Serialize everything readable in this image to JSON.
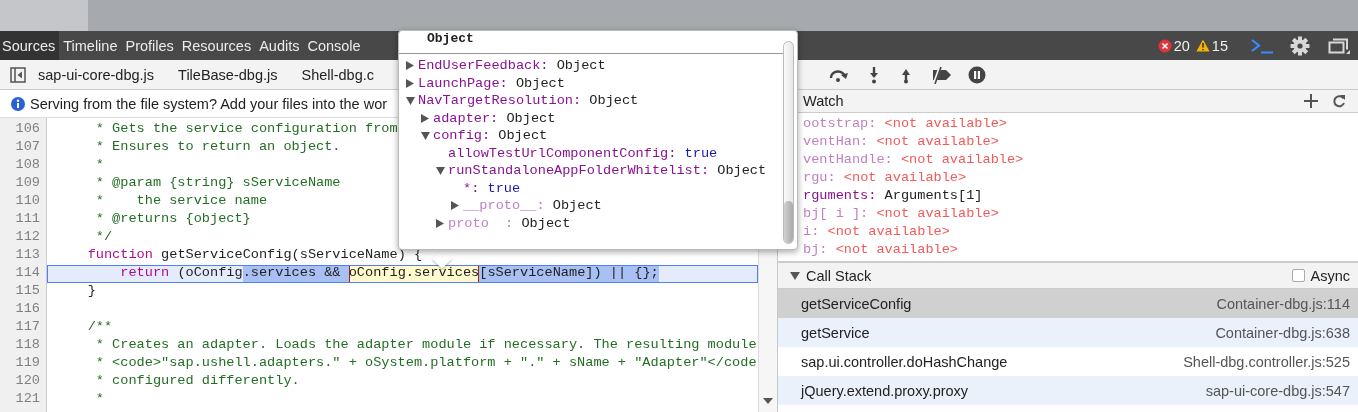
{
  "main_tabs": [
    {
      "label": "Sources",
      "selected": true
    },
    {
      "label": "Timeline",
      "selected": false
    },
    {
      "label": "Profiles",
      "selected": false
    },
    {
      "label": "Resources",
      "selected": false
    },
    {
      "label": "Audits",
      "selected": false
    },
    {
      "label": "Console",
      "selected": false
    }
  ],
  "status": {
    "errors": "20",
    "warnings": "15"
  },
  "file_tabs": [
    {
      "label": "sap-ui-core-dbg.js"
    },
    {
      "label": "TileBase-dbg.js"
    },
    {
      "label": "Shell-dbg.c"
    }
  ],
  "info_bar": {
    "text": "Serving from the file system? Add your files into the wor"
  },
  "code_lines": [
    {
      "number": "106",
      "tokens": [
        {
          "text": "     * Gets the service configuration from",
          "kind": "comment"
        }
      ]
    },
    {
      "number": "107",
      "tokens": [
        {
          "text": "     * Ensures to return an object.",
          "kind": "comment"
        }
      ]
    },
    {
      "number": "108",
      "tokens": [
        {
          "text": "     *",
          "kind": "comment"
        }
      ]
    },
    {
      "number": "109",
      "tokens": [
        {
          "text": "     * @param {string} sServiceName",
          "kind": "comment"
        }
      ]
    },
    {
      "number": "110",
      "tokens": [
        {
          "text": "     *    the service name",
          "kind": "comment"
        }
      ]
    },
    {
      "number": "111",
      "tokens": [
        {
          "text": "     * @returns {object}",
          "kind": "comment"
        }
      ]
    },
    {
      "number": "112",
      "tokens": [
        {
          "text": "     */",
          "kind": "comment"
        }
      ]
    },
    {
      "number": "113",
      "current": false,
      "tokens": [
        {
          "text": "    function",
          "kind": "keyword"
        },
        {
          "text": " getServiceConfig(sServiceName) {",
          "kind": "plain"
        }
      ]
    },
    {
      "number": "114",
      "current": true,
      "tokens": [
        {
          "text": "        return",
          "kind": "keyword"
        },
        {
          "text": " (oConfig",
          "kind": "plain"
        },
        {
          "text": ".services && ",
          "kind": "selection"
        },
        {
          "text": "oConfig.services",
          "kind": "evaluated"
        },
        {
          "text": "[sServiceName]) || {};",
          "kind": "selection"
        }
      ]
    },
    {
      "number": "115",
      "tokens": [
        {
          "text": "    }",
          "kind": "plain"
        }
      ]
    },
    {
      "number": "116"
    },
    {
      "number": "117",
      "tokens": [
        {
          "text": "    /**",
          "kind": "comment"
        }
      ]
    },
    {
      "number": "118",
      "tokens": [
        {
          "text": "     * Creates an adapter. Loads the adapter module if necessary. The resulting module",
          "kind": "comment"
        }
      ]
    },
    {
      "number": "119",
      "tokens": [
        {
          "text": "     * <code>\"sap.ushell.adapters.\" + oSystem.platform + \".\" + sName + \"Adapter\"</code",
          "kind": "comment"
        }
      ]
    },
    {
      "number": "120",
      "tokens": [
        {
          "text": "     * configured differently.",
          "kind": "comment"
        }
      ]
    },
    {
      "number": "121",
      "tokens": [
        {
          "text": "     *",
          "kind": "comment"
        }
      ]
    }
  ],
  "popover": {
    "title": "Object",
    "nodes": [
      {
        "name": "EndUserFeedback:",
        "value": "Object",
        "literal": false,
        "dim": false,
        "expanded": false
      },
      {
        "name": "LaunchPage:",
        "value": "Object",
        "literal": false,
        "dim": false,
        "expanded": false
      },
      {
        "name": "NavTargetResolution:",
        "value": "Object",
        "literal": false,
        "dim": false,
        "expanded": true,
        "children": [
          {
            "name": "adapter:",
            "value": "Object",
            "literal": false,
            "dim": false,
            "expanded": false
          },
          {
            "name": "config:",
            "value": "Object",
            "literal": false,
            "dim": false,
            "expanded": true,
            "children": [
              {
                "name": "allowTestUrlComponentConfig:",
                "value": "true",
                "literal": true,
                "dim": false
              },
              {
                "name": "runStandaloneAppFolderWhitelist:",
                "value": "Object",
                "literal": false,
                "dim": false,
                "expanded": true,
                "children": [
                  {
                    "name": "*:",
                    "value": "true",
                    "literal": true,
                    "dim": false
                  },
                  {
                    "name": "__proto__:",
                    "value": "Object",
                    "literal": false,
                    "dim": true,
                    "expanded": false
                  }
                ]
              },
              {
                "name": "proto  :",
                "value": "Object",
                "literal": false,
                "dim": true,
                "expanded": false
              }
            ]
          }
        ]
      }
    ]
  },
  "watch": {
    "title": "Watch",
    "items": [
      {
        "name": "ootstrap:",
        "value": "<not available>",
        "available": false
      },
      {
        "name": "ventHan:",
        "value": "<not available>",
        "available": false
      },
      {
        "name": "ventHandle:",
        "value": "<not available>",
        "available": false
      },
      {
        "name": "rgu:",
        "value": "<not available>",
        "available": false
      },
      {
        "name": "rguments:",
        "value": "Arguments[1]",
        "available": true
      },
      {
        "name": "bj[ i ]:",
        "value": "<not available>",
        "available": false
      },
      {
        "name": "i:",
        "value": "<not available>",
        "available": false
      },
      {
        "name": "bj:",
        "value": "<not available>",
        "available": false
      }
    ]
  },
  "call_stack": {
    "title": "Call Stack",
    "expanded": true,
    "async_label": "Async",
    "async_checked": false,
    "frames": [
      {
        "function": "getServiceConfig",
        "location": "Container-dbg.js:114",
        "selected": true
      },
      {
        "function": "getService",
        "location": "Container-dbg.js:638",
        "selected": false
      },
      {
        "function": "sap.ui.controller.doHashChange",
        "location": "Shell-dbg.controller.js:525",
        "selected": false
      },
      {
        "function": "jQuery.extend.proxy.proxy",
        "location": "sap-ui-core-dbg.js:547",
        "selected": false
      }
    ]
  }
}
